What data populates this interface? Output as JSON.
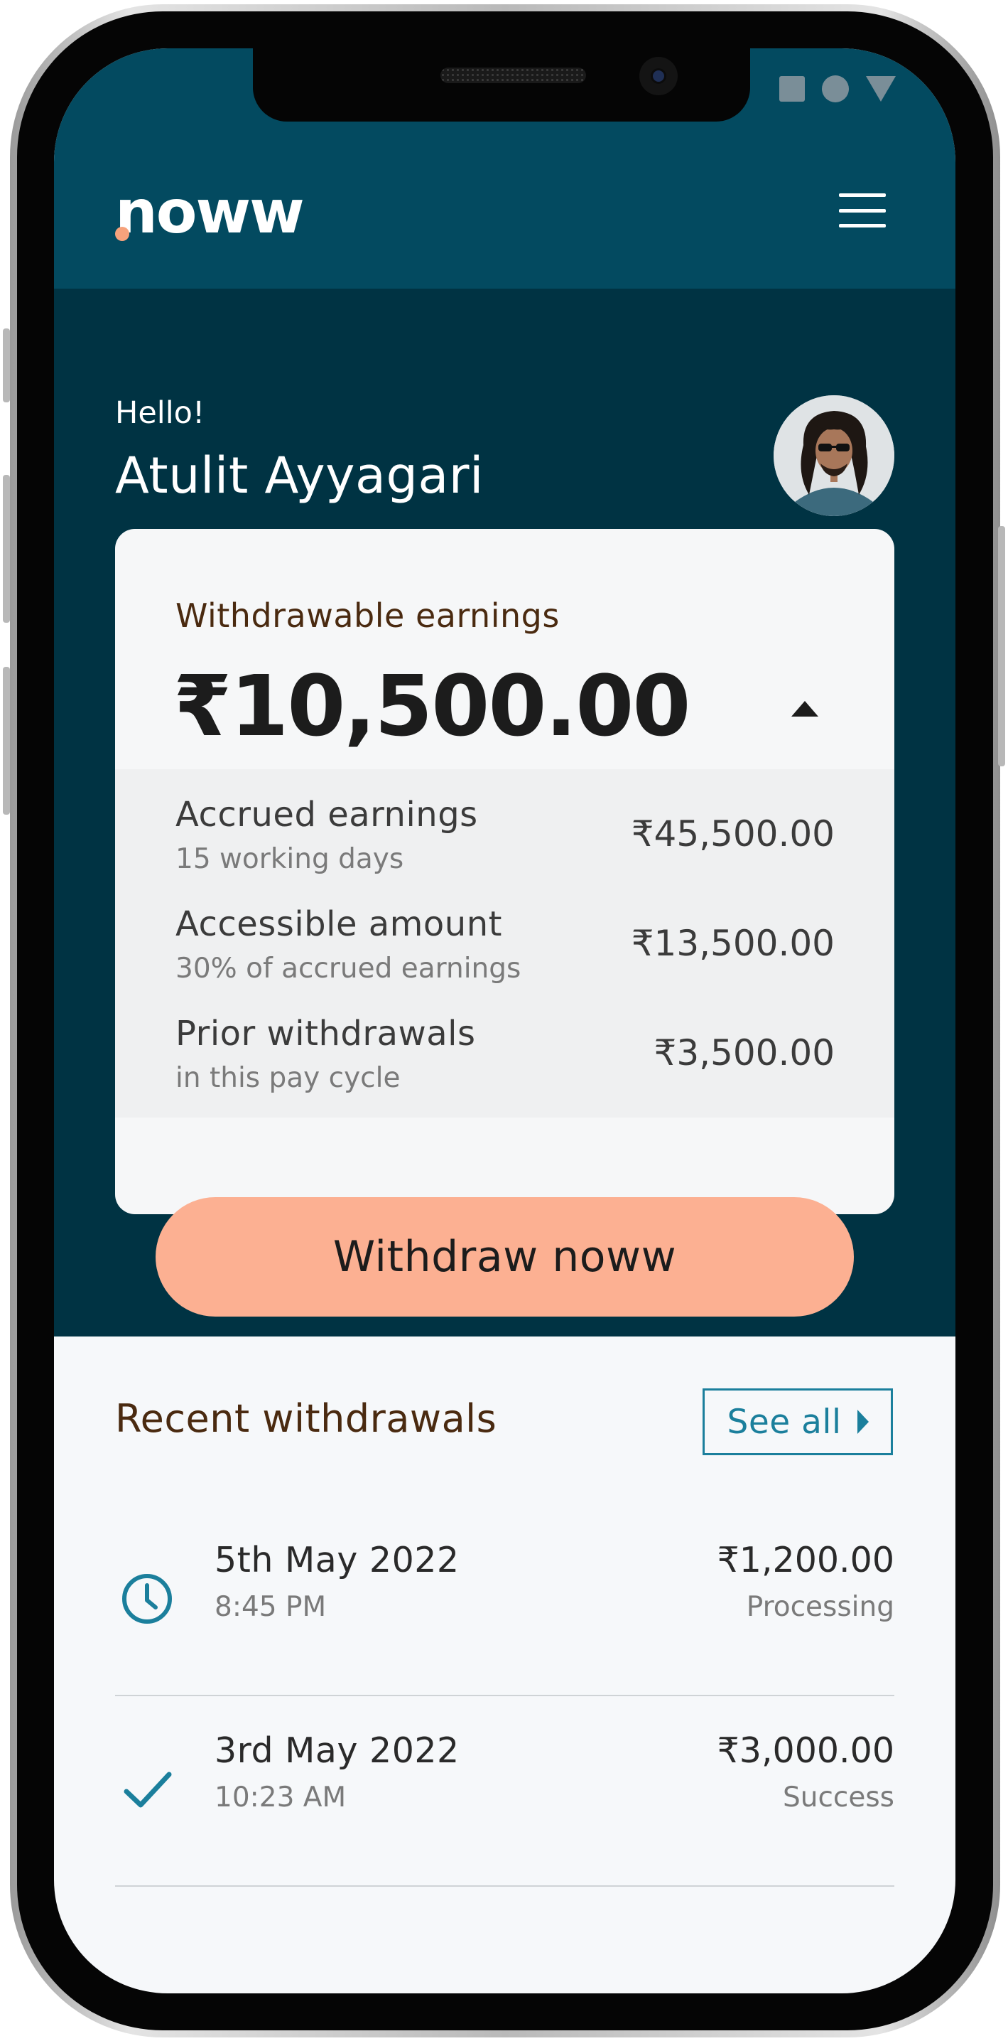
{
  "app": {
    "brand": "noww",
    "colors": {
      "header": "#034a60",
      "hero": "#003343",
      "accent": "#fcb092",
      "link": "#1b7f9c",
      "heading_brown": "#4a2a10"
    }
  },
  "header": {
    "logo_text": "noww",
    "menu_icon": "hamburger-menu-icon"
  },
  "status_bar": {
    "icons": [
      "square-icon",
      "circle-icon",
      "triangle-icon"
    ]
  },
  "greeting": {
    "hello": "Hello!",
    "name": "Atulit Ayyagari"
  },
  "earnings_card": {
    "label": "Withdrawable earnings",
    "amount": "₹10,500.00",
    "toggle_icon": "caret-up-icon",
    "breakdown": [
      {
        "title": "Accrued earnings",
        "subtitle": "15 working days",
        "value": "₹45,500.00"
      },
      {
        "title": "Accessible amount",
        "subtitle": "30% of accrued earnings",
        "value": "₹13,500.00"
      },
      {
        "title": "Prior withdrawals",
        "subtitle": "in this pay cycle",
        "value": "₹3,500.00"
      }
    ],
    "cta_label": "Withdraw noww"
  },
  "recent": {
    "title": "Recent withdrawals",
    "see_all_label": "See all",
    "items": [
      {
        "date": "5th May 2022",
        "time": "8:45 PM",
        "amount": "₹1,200.00",
        "status": "Processing",
        "icon": "clock-icon"
      },
      {
        "date": "3rd May 2022",
        "time": "10:23 AM",
        "amount": "₹3,000.00",
        "status": "Success",
        "icon": "checkmark-icon"
      }
    ]
  }
}
